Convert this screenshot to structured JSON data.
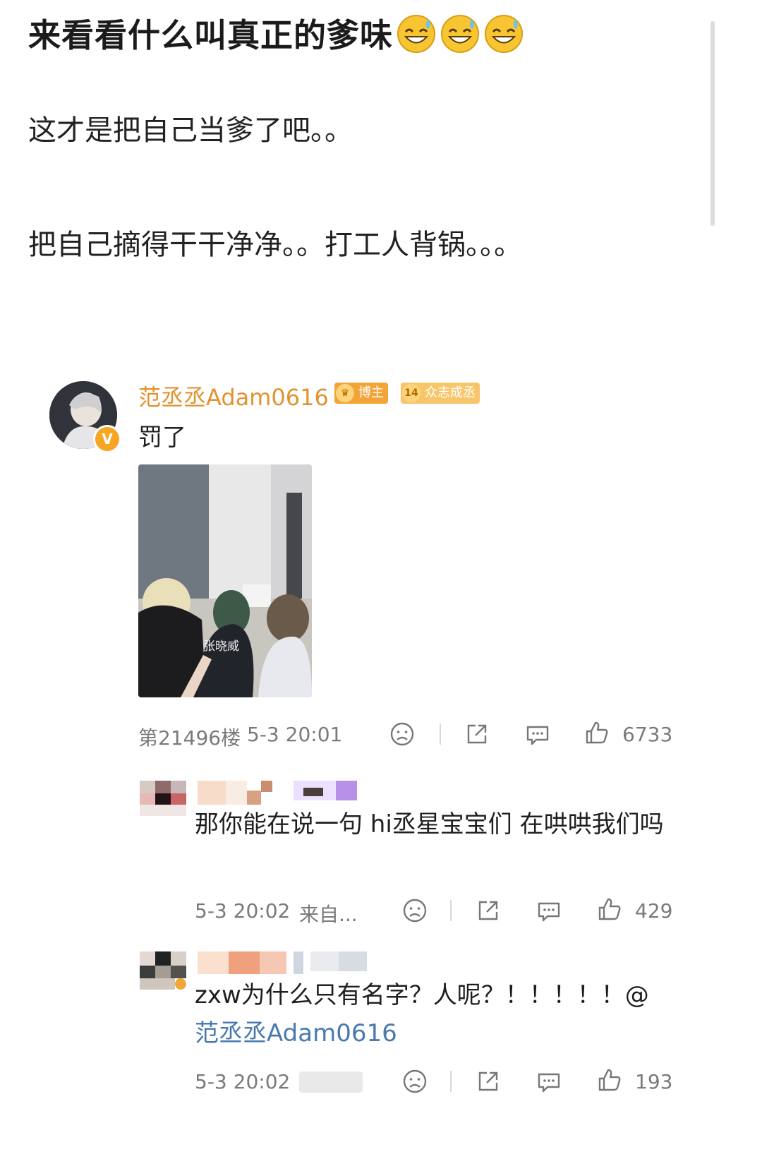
{
  "post": {
    "title": "来看看什么叫真正的爹味",
    "line1": "这才是把自己当爹了吧。。",
    "line2": "把自己摘得干干净净。。打工人背锅。。。"
  },
  "main_comment": {
    "username": "范丞丞Adam0616",
    "badge_boss": "博主",
    "badge_fan_level": "14",
    "badge_fan": "众志成丞",
    "verified_mark": "V",
    "text": "罚了",
    "photo_caption": "张晓威",
    "floor": "第21496楼",
    "time": "5-3 20:01",
    "likes": "6733"
  },
  "replies": [
    {
      "text": "那你能在说一句 hi丞星宝宝们 在哄哄我们吗",
      "time": "5-3 20:02",
      "source": "来自...",
      "likes": "429"
    },
    {
      "text": "zxw为什么只有名字？人呢？！！！！！@",
      "mention": "范丞丞Adam0616",
      "time": "5-3 20:02",
      "likes": "193"
    }
  ],
  "icons": {
    "dislike": "sad-face-icon",
    "share": "share-icon",
    "comment": "comment-icon",
    "like": "thumbs-up-icon"
  },
  "colors": {
    "username": "#e2922e",
    "mention": "#4a79b0",
    "meta": "#7a7a7a"
  }
}
